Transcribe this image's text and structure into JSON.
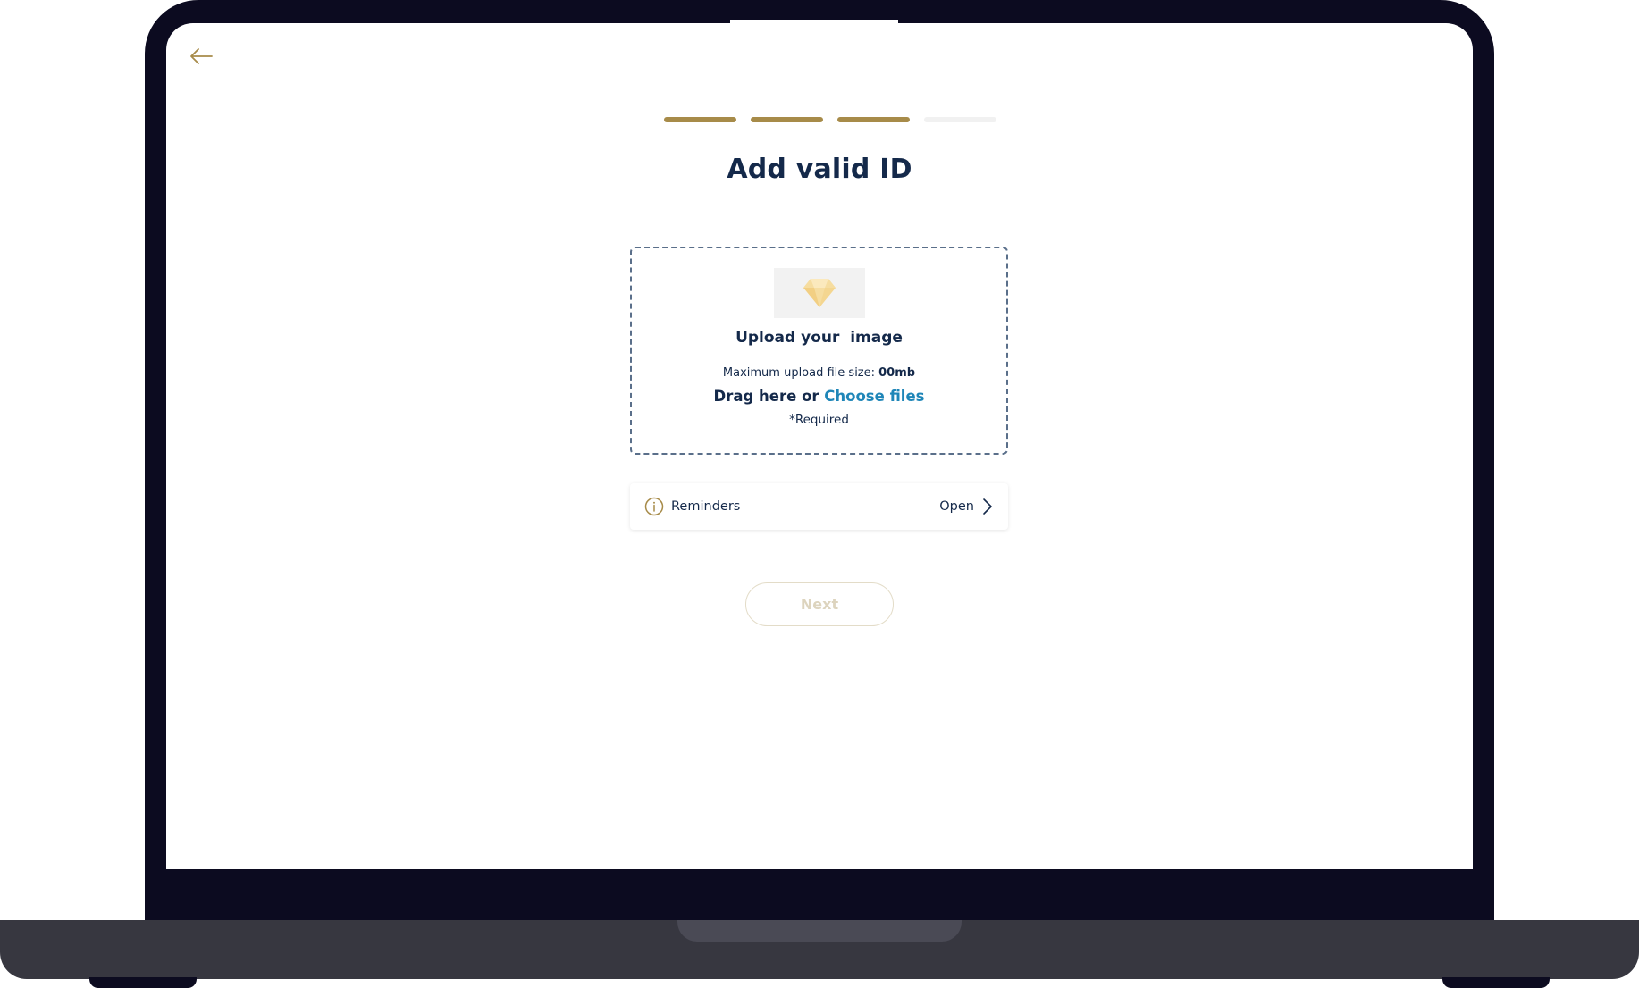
{
  "header": {
    "back_icon": "arrow-left-icon"
  },
  "progress": {
    "total_steps": 4,
    "completed_steps": 3,
    "active_color": "#a78b49",
    "inactive_color": "#f1f1f1"
  },
  "page": {
    "title": "Add valid ID"
  },
  "upload": {
    "icon": "diamond-icon",
    "title": "Upload your  image",
    "max_size_label": "Maximum upload file size: ",
    "max_size_value": "00mb",
    "drag_text": "Drag here or ",
    "choose_link": "Choose files",
    "required": "*Required"
  },
  "reminders": {
    "icon": "info-icon",
    "label": "Reminders",
    "action": "Open",
    "action_icon": "chevron-right-icon"
  },
  "footer": {
    "next_label": "Next"
  },
  "colors": {
    "primary_text": "#14294a",
    "accent_gold": "#a78b49",
    "link_blue": "#1f86b8",
    "frame": "#0c0b20"
  }
}
